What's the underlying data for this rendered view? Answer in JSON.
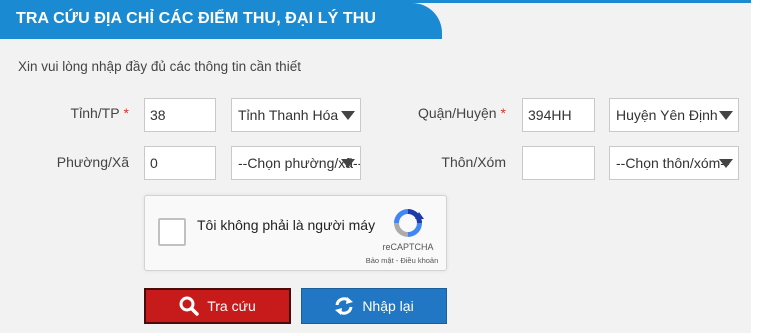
{
  "header": {
    "title": "TRA CỨU ĐỊA CHỈ CÁC ĐIỂM THU, ĐẠI LÝ THU"
  },
  "intro": "Xin vui lòng nhập đầy đủ các thông tin cần thiết",
  "form": {
    "province": {
      "label": "Tỉnh/TP",
      "required_mark": "*",
      "code": "38",
      "selected": "Tỉnh Thanh Hóa"
    },
    "district": {
      "label": "Quận/Huyện",
      "required_mark": "*",
      "code": "394HH",
      "selected": "Huyện Yên Định"
    },
    "ward": {
      "label": "Phường/Xã",
      "code": "0",
      "selected": "--Chọn phường/xã--"
    },
    "hamlet": {
      "label": "Thôn/Xóm",
      "code": "",
      "selected": "--Chọn thôn/xóm--"
    }
  },
  "recaptcha": {
    "label": "Tôi không phải là người máy",
    "brand": "reCAPTCHA",
    "terms": "Bảo mật - Điều khoản"
  },
  "buttons": {
    "search": "Tra cứu",
    "reset": "Nhập lại"
  },
  "colors": {
    "header_blue": "#1a8ad2",
    "search_red": "#c71a1a",
    "reset_blue": "#2177c4",
    "required_red": "#d9342b"
  },
  "icons": {
    "search": "search-icon",
    "reset": "refresh-icon",
    "caret": "caret-down-icon"
  }
}
